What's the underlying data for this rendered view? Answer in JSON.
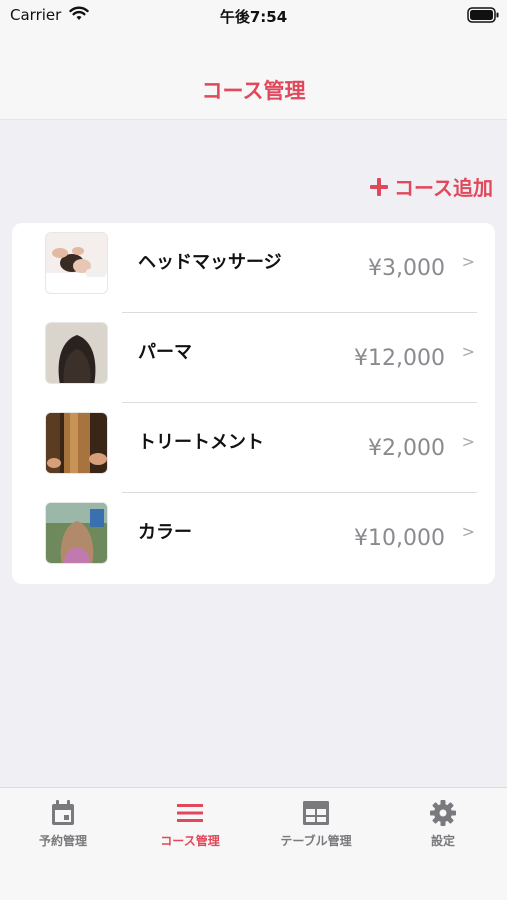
{
  "status_bar": {
    "carrier": "Carrier",
    "time": "午後7:54"
  },
  "nav": {
    "title": "コース管理"
  },
  "add_course": {
    "label": "コース追加"
  },
  "courses": [
    {
      "name": "ヘッドマッサージ",
      "price": "¥3,000",
      "thumbnail": "head-massage-photo"
    },
    {
      "name": "パーマ",
      "price": "¥12,000",
      "thumbnail": "perm-hair-photo"
    },
    {
      "name": "トリートメント",
      "price": "¥2,000",
      "thumbnail": "treatment-hair-photo"
    },
    {
      "name": "カラー",
      "price": "¥10,000",
      "thumbnail": "color-hair-photo"
    }
  ],
  "tabs": [
    {
      "label": "予約管理",
      "icon": "calendar-icon",
      "active": false
    },
    {
      "label": "コース管理",
      "icon": "list-icon",
      "active": true
    },
    {
      "label": "テーブル管理",
      "icon": "table-icon",
      "active": false
    },
    {
      "label": "設定",
      "icon": "gear-icon",
      "active": false
    }
  ],
  "colors": {
    "accent": "#e0485c",
    "background": "#efeff4",
    "inactive": "#7a7a7e"
  }
}
